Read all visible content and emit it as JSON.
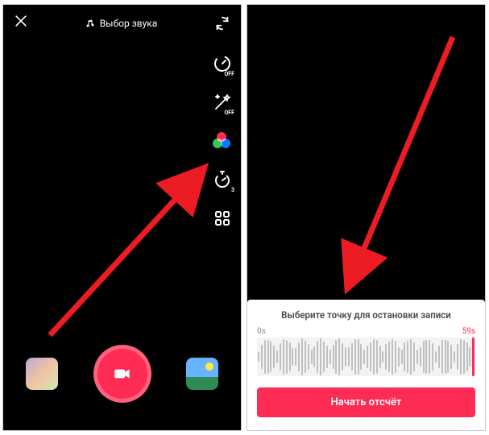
{
  "left": {
    "sound_label": "Выбор звука",
    "tools": {
      "speed_badge": "OFF",
      "beauty_badge": "OFF",
      "timer_badge": "3"
    }
  },
  "right": {
    "sheet_title": "Выберите точку для остановки записи",
    "start_label": "0s",
    "end_label": "59s",
    "start_button": "Начать отсчёт"
  }
}
